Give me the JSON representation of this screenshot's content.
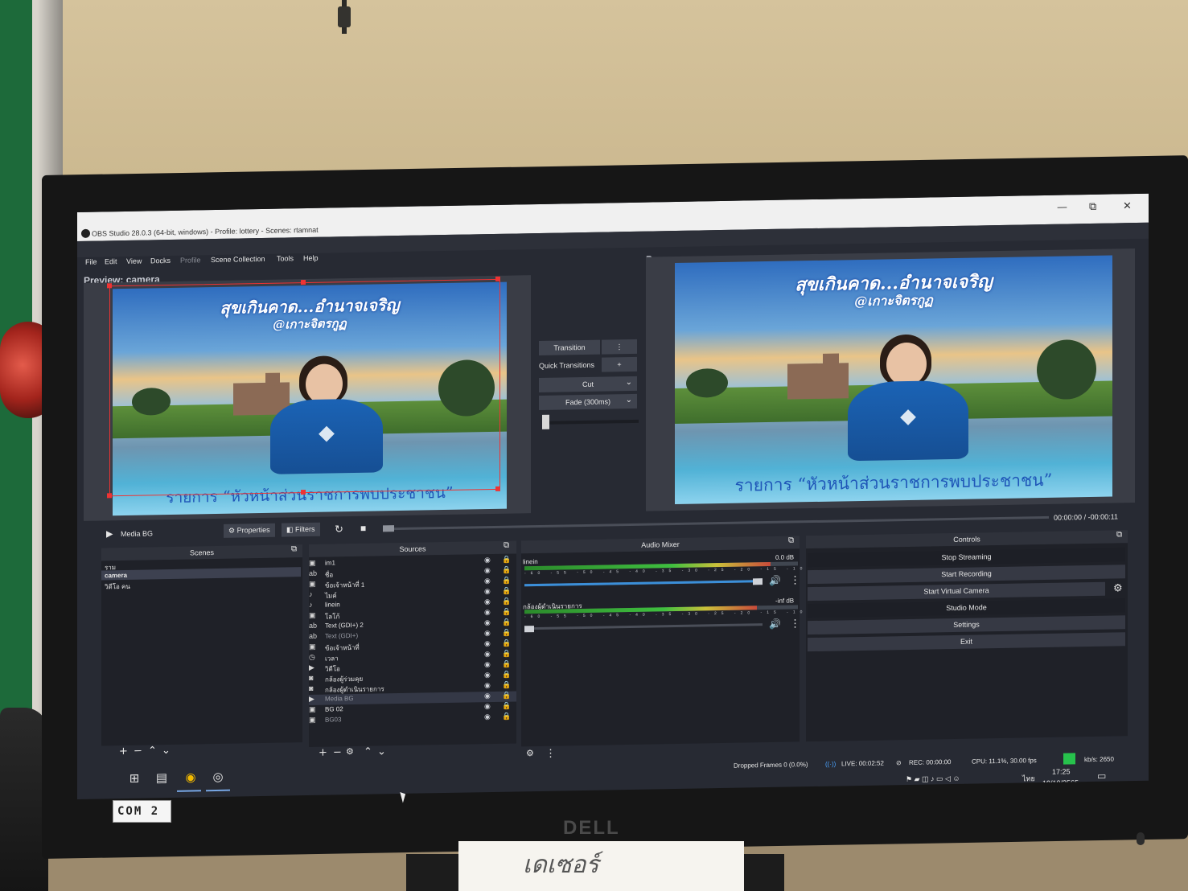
{
  "window": {
    "title": "OBS Studio 28.0.3 (64-bit, windows) - Profile: lottery - Scenes: rtamnat",
    "minimize": "—",
    "restore": "⧉",
    "close": "✕"
  },
  "menu": [
    "File",
    "Edit",
    "View",
    "Docks",
    "Profile",
    "Scene Collection",
    "Tools",
    "Help"
  ],
  "preview_label": "Preview: camera",
  "program_label": "Program: camera",
  "scene_image": {
    "title": "สุขเกินคาด...อำนาจเจริญ",
    "subtitle": "@เกาะจิตรกูฏ",
    "banner": "รายการ “หัวหน้าส่วนราชการพบประชาชน”"
  },
  "transitions": {
    "transition_button": "Transition",
    "quick_transitions": "Quick Transitions",
    "cut": "Cut",
    "fade": "Fade (300ms)"
  },
  "media_controls": {
    "source_name": "Media BG",
    "properties": "Properties",
    "filters": "Filters",
    "time": "00:00:00",
    "separator": "/",
    "remaining": "-00:00:11"
  },
  "docks": {
    "scenes": "Scenes",
    "sources": "Sources",
    "audio_mixer": "Audio Mixer",
    "controls": "Controls"
  },
  "scenes": [
    "ราม",
    "camera",
    "วิดีโอ คน"
  ],
  "sources": [
    {
      "name": "im1",
      "icon": "image-icon"
    },
    {
      "name": "ชื่อ",
      "icon": "text-icon"
    },
    {
      "name": "ข้อเจ้าหน้าที่ 1",
      "icon": "image-icon"
    },
    {
      "name": "ไมค์",
      "icon": "mic-icon"
    },
    {
      "name": "linein",
      "icon": "mic-icon"
    },
    {
      "name": "โลโก้",
      "icon": "image-icon"
    },
    {
      "name": "Text (GDI+) 2",
      "icon": "text-icon"
    },
    {
      "name": "Text (GDI+)",
      "icon": "text-icon"
    },
    {
      "name": "ข้อเจ้าหน้าที่",
      "icon": "image-icon"
    },
    {
      "name": "เวลา",
      "icon": "clock-icon"
    },
    {
      "name": "วิดีโอ",
      "icon": "media-icon"
    },
    {
      "name": "กล้องผู้ร่วมคุย",
      "icon": "camera-icon"
    },
    {
      "name": "กล้องผู้ดำเนินรายการ",
      "icon": "camera-icon"
    },
    {
      "name": "Media BG",
      "icon": "media-icon"
    },
    {
      "name": "BG 02",
      "icon": "image-icon"
    },
    {
      "name": "BG03",
      "icon": "image-icon"
    }
  ],
  "audio_mixer": {
    "channels": [
      {
        "name": "linein",
        "db": "0.0 dB",
        "volume": 1.0,
        "level": 0.9
      },
      {
        "name": "กล้องผู้ดำเนินรายการ",
        "db": "-inf dB",
        "volume": 0.0,
        "level": 0.85
      }
    ],
    "ticks": "-60 -55 -50 -45 -40 -35 -30 -25 -20 -15 -10 -5 0"
  },
  "controls": [
    "Stop Streaming",
    "Start Recording",
    "Start Virtual Camera",
    "Studio Mode",
    "Settings",
    "Exit"
  ],
  "status": {
    "dropped": "Dropped Frames 0 (0.0%)",
    "live": "LIVE: 00:02:52",
    "rec": "REC: 00:00:00",
    "cpu": "CPU: 11.1%, 30.00 fps",
    "kbs": "kb/s: 2650"
  },
  "taskbar": {
    "time": "17:25",
    "date": "19/10/2565",
    "lang": "ไทย"
  },
  "monitor": {
    "brand": "DELL",
    "label": "COM 2"
  },
  "paper_note": "เดเซอร์"
}
